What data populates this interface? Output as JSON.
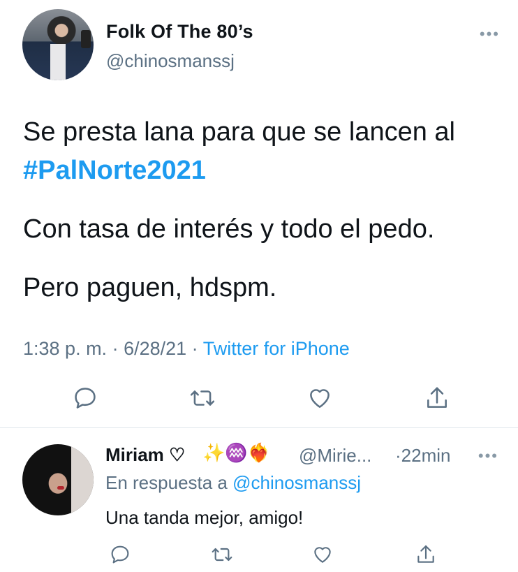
{
  "tweet": {
    "display_name": "Folk Of The 80’s",
    "handle": "@chinosmanssj",
    "more_icon": "more-horizontal-icon",
    "text_line1": "Se presta lana para que se lancen al",
    "hashtag": "#PalNorte2021",
    "text_line2": "Con tasa de interés y todo el pedo.",
    "text_line3": "Pero paguen, hdspm.",
    "time": "1:38 p. m.",
    "separator1": " · ",
    "date": "6/28/21",
    "separator2": " · ",
    "source": "Twitter for iPhone"
  },
  "actions": [
    {
      "name": "reply",
      "icon": "reply-icon"
    },
    {
      "name": "retweet",
      "icon": "retweet-icon"
    },
    {
      "name": "like",
      "icon": "heart-icon"
    },
    {
      "name": "share",
      "icon": "share-icon"
    }
  ],
  "reply": {
    "display_name": "Miriam ♡",
    "emojis": "✨♒❤️‍🔥",
    "handle": "@Mirie...",
    "time": "·22min",
    "replying_prefix": "En respuesta a ",
    "replying_to": "@chinosmanssj",
    "text": "Una tanda mejor, amigo!"
  },
  "colors": {
    "accent": "#1d9bf0",
    "secondary_text": "#5b7083",
    "divider": "#e1e8ed"
  }
}
